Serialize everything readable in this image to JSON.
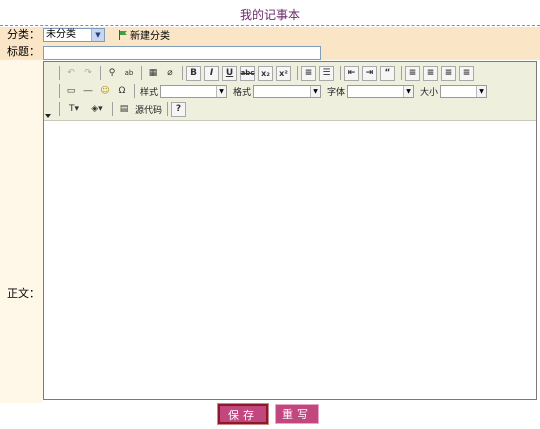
{
  "page_title": "我的记事本",
  "category": {
    "label": "分类：",
    "selected": "未分类",
    "new_label": "新建分类"
  },
  "title_field": {
    "label": "标题：",
    "value": ""
  },
  "body": {
    "label": "正文："
  },
  "toolbar": {
    "style_label": "样式",
    "format_label": "格式",
    "font_label": "字体",
    "size_label": "大小",
    "source_label": "源代码"
  },
  "buttons": {
    "save": "保存",
    "reset": "重写"
  }
}
